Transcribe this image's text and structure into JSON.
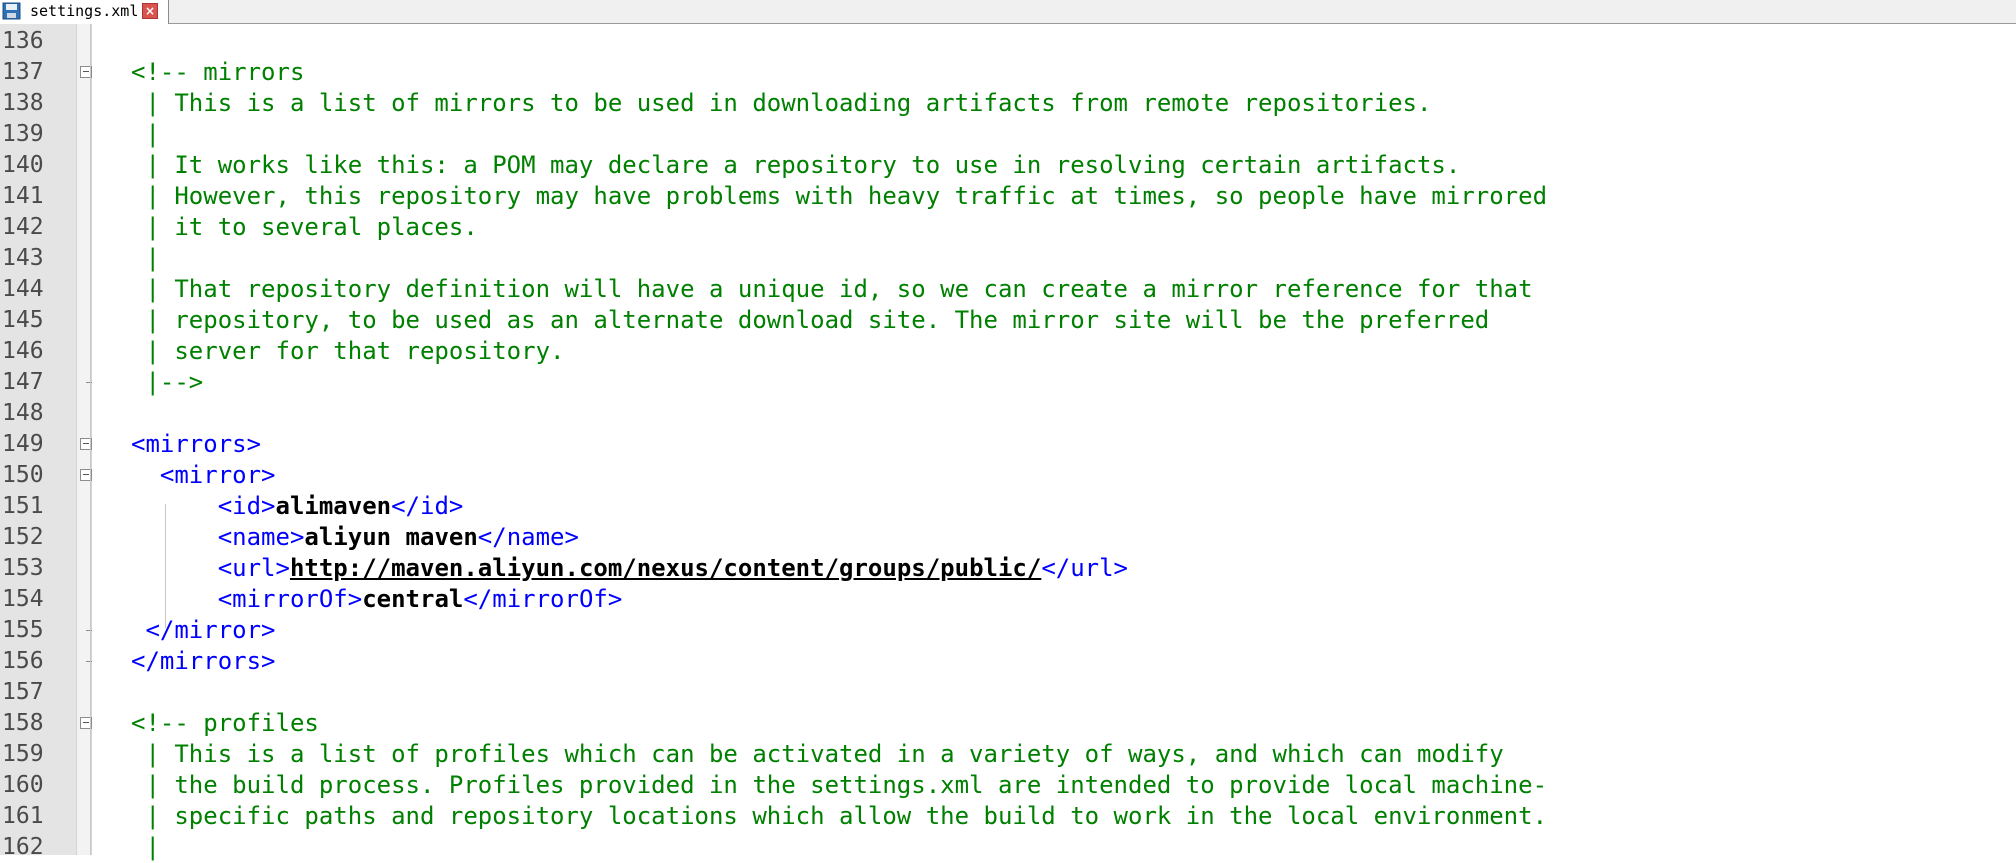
{
  "tab": {
    "filename": "settings.xml"
  },
  "lines": [
    {
      "n": "136",
      "text": ""
    },
    {
      "n": "137",
      "text": "<!-- mirrors",
      "fold": "open"
    },
    {
      "n": "138",
      "text": " | This is a list of mirrors to be used in downloading artifacts from remote repositories."
    },
    {
      "n": "139",
      "text": " |"
    },
    {
      "n": "140",
      "text": " | It works like this: a POM may declare a repository to use in resolving certain artifacts."
    },
    {
      "n": "141",
      "text": " | However, this repository may have problems with heavy traffic at times, so people have mirrored"
    },
    {
      "n": "142",
      "text": " | it to several places."
    },
    {
      "n": "143",
      "text": " |"
    },
    {
      "n": "144",
      "text": " | That repository definition will have a unique id, so we can create a mirror reference for that"
    },
    {
      "n": "145",
      "text": " | repository, to be used as an alternate download site. The mirror site will be the preferred"
    },
    {
      "n": "146",
      "text": " | server for that repository."
    },
    {
      "n": "147",
      "text": " |-->",
      "fold": "end"
    },
    {
      "n": "148",
      "text": ""
    },
    {
      "n": "149",
      "indent": "",
      "open": "<mirrors>",
      "fold": "open"
    },
    {
      "n": "150",
      "indent": "  ",
      "open": "<mirror>",
      "fold": "open"
    },
    {
      "n": "151",
      "indent": "      ",
      "open": "<id>",
      "value": "alimaven",
      "close": "</id>"
    },
    {
      "n": "152",
      "indent": "      ",
      "open": "<name>",
      "value": "aliyun maven",
      "close": "</name>"
    },
    {
      "n": "153",
      "indent": "      ",
      "open": "<url>",
      "value": "http://maven.aliyun.com/nexus/content/groups/public/",
      "close": "</url>",
      "link": true
    },
    {
      "n": "154",
      "indent": "      ",
      "open": "<mirrorOf>",
      "value": "central",
      "close": "</mirrorOf>"
    },
    {
      "n": "155",
      "indent": " ",
      "open": "</mirror>",
      "fold": "end"
    },
    {
      "n": "156",
      "indent": "",
      "open": "</mirrors>",
      "fold": "end"
    },
    {
      "n": "157",
      "text": ""
    },
    {
      "n": "158",
      "text": "<!-- profiles",
      "fold": "open"
    },
    {
      "n": "159",
      "text": " | This is a list of profiles which can be activated in a variety of ways, and which can modify"
    },
    {
      "n": "160",
      "text": " | the build process. Profiles provided in the settings.xml are intended to provide local machine-"
    },
    {
      "n": "161",
      "text": " | specific paths and repository locations which allow the build to work in the local environment."
    },
    {
      "n": "162",
      "text": " |"
    }
  ]
}
